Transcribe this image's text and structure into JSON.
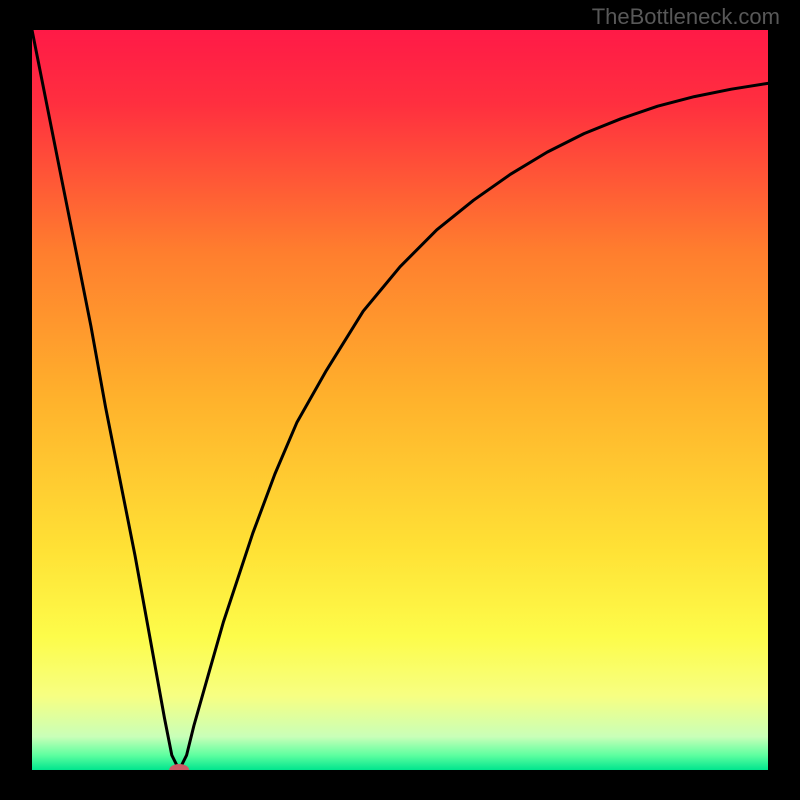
{
  "watermark": "TheBottleneck.com",
  "chart_data": {
    "type": "line",
    "title": "",
    "xlabel": "",
    "ylabel": "",
    "xlim": [
      0,
      100
    ],
    "ylim": [
      0,
      100
    ],
    "gradient_stops": [
      {
        "offset": 0.0,
        "color": "#ff1a47"
      },
      {
        "offset": 0.1,
        "color": "#ff2f3f"
      },
      {
        "offset": 0.3,
        "color": "#ff7e2e"
      },
      {
        "offset": 0.5,
        "color": "#ffb22c"
      },
      {
        "offset": 0.7,
        "color": "#ffe135"
      },
      {
        "offset": 0.82,
        "color": "#fdfc4a"
      },
      {
        "offset": 0.9,
        "color": "#f7ff82"
      },
      {
        "offset": 0.955,
        "color": "#c9ffb8"
      },
      {
        "offset": 0.98,
        "color": "#5effa0"
      },
      {
        "offset": 1.0,
        "color": "#00e58e"
      }
    ],
    "series": [
      {
        "name": "bottleneck-curve",
        "x": [
          0,
          2,
          4,
          6,
          8,
          10,
          12,
          14,
          16,
          18,
          19,
          20,
          21,
          22,
          24,
          26,
          28,
          30,
          33,
          36,
          40,
          45,
          50,
          55,
          60,
          65,
          70,
          75,
          80,
          85,
          90,
          95,
          100
        ],
        "y": [
          100,
          90,
          80,
          70,
          60,
          49,
          39,
          29,
          18,
          7,
          2,
          0,
          2,
          6,
          13,
          20,
          26,
          32,
          40,
          47,
          54,
          62,
          68,
          73,
          77,
          80.5,
          83.5,
          86,
          88,
          89.7,
          91,
          92,
          92.8
        ]
      }
    ],
    "marker": {
      "x": 20,
      "y": 0,
      "color": "#cc5a66",
      "rx": 10,
      "ry": 6
    }
  }
}
